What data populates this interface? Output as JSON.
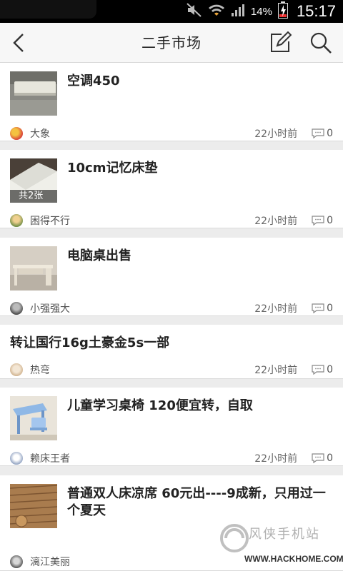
{
  "status_bar": {
    "battery_percent": "14%",
    "time": "15:17"
  },
  "nav": {
    "title": "二手市场"
  },
  "items": [
    {
      "title": "空调450",
      "author": "大象",
      "time": "22小时前",
      "comments": "0"
    },
    {
      "title": "10cm记忆床垫",
      "image_badge": "共2张",
      "author": "困得不行",
      "time": "22小时前",
      "comments": "0"
    },
    {
      "title": "电脑桌出售",
      "author": "小强强大",
      "time": "22小时前",
      "comments": "0"
    },
    {
      "title": "转让国行16g土豪金5s一部",
      "author": "热弯",
      "time": "22小时前",
      "comments": "0"
    },
    {
      "title": "儿童学习桌椅 120便宜转，自取",
      "author": "赖床王者",
      "time": "22小时前",
      "comments": "0"
    },
    {
      "title": "普通双人床凉席  60元出----9成新，只用过一个夏天",
      "author": "漓江美丽"
    }
  ],
  "watermark": {
    "text": "风侠手机站",
    "url": "WWW.HACKHOME.COM"
  }
}
